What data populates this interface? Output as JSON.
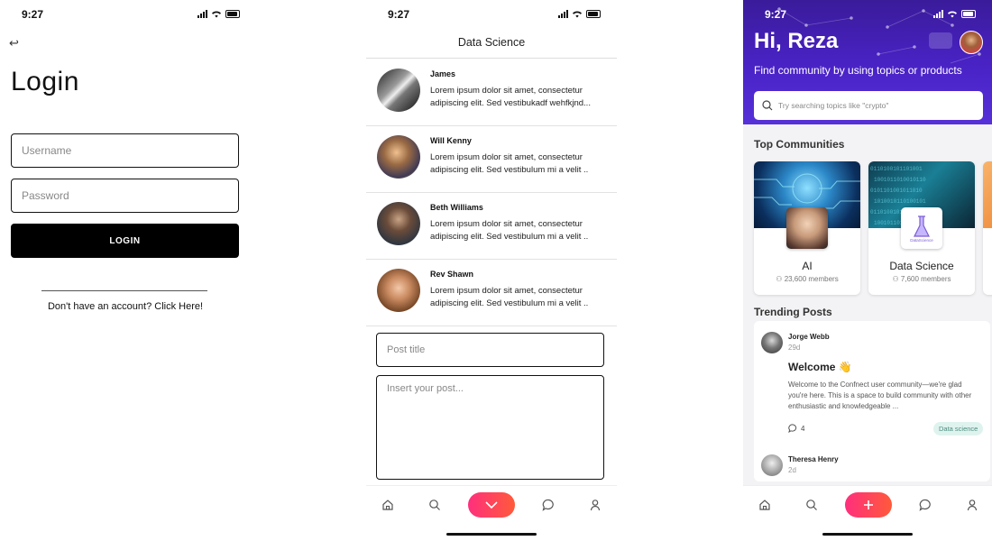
{
  "status": {
    "time": "9:27"
  },
  "login": {
    "title": "Login",
    "username_placeholder": "Username",
    "password_placeholder": "Password",
    "login_button": "LOGIN",
    "signup_text": "Don't have an account? Click Here!"
  },
  "chat": {
    "header": "Data Science",
    "messages": [
      {
        "name": "James",
        "text": "Lorem ipsum dolor sit amet, consectetur adipiscing elit. Sed vestibukadf wehfkjnd..."
      },
      {
        "name": "Will Kenny",
        "text": "Lorem ipsum dolor sit amet, consectetur adipiscing elit. Sed vestibulum mi a velit .."
      },
      {
        "name": "Beth Williams",
        "text": "Lorem ipsum dolor sit amet, consectetur adipiscing elit. Sed vestibulum mi a velit .."
      },
      {
        "name": "Rev Shawn",
        "text": "Lorem ipsum dolor sit amet, consectetur adipiscing elit. Sed vestibulum mi a velit .."
      }
    ],
    "post_title_placeholder": "Post title",
    "post_body_placeholder": "Insert your post..."
  },
  "home": {
    "greeting": "Hi, Reza",
    "subtitle": "Find community by using topics or products",
    "search_placeholder": "Try searching topics like \"crypto\"",
    "top_communities_label": "Top Communities",
    "communities": [
      {
        "name": "AI",
        "members": "23,600 members"
      },
      {
        "name": "Data Science",
        "members": "7,600 members"
      }
    ],
    "trending_label": "Trending Posts",
    "posts": [
      {
        "author": "Jorge Webb",
        "time": "29d",
        "title": "Welcome 👋",
        "body": "Welcome to the Confnect user community—we're glad you're here. This is a space to build community with other enthusiastic and knowledgeable ...",
        "comments": "4",
        "tag": "Data science"
      },
      {
        "author": "Theresa Henry",
        "time": "2d"
      }
    ],
    "ds_logo_text": "DataScience"
  },
  "colors": {
    "accent_start": "#ff2f7d",
    "accent_end": "#ff5a3a",
    "hero": "#4a23c7"
  }
}
